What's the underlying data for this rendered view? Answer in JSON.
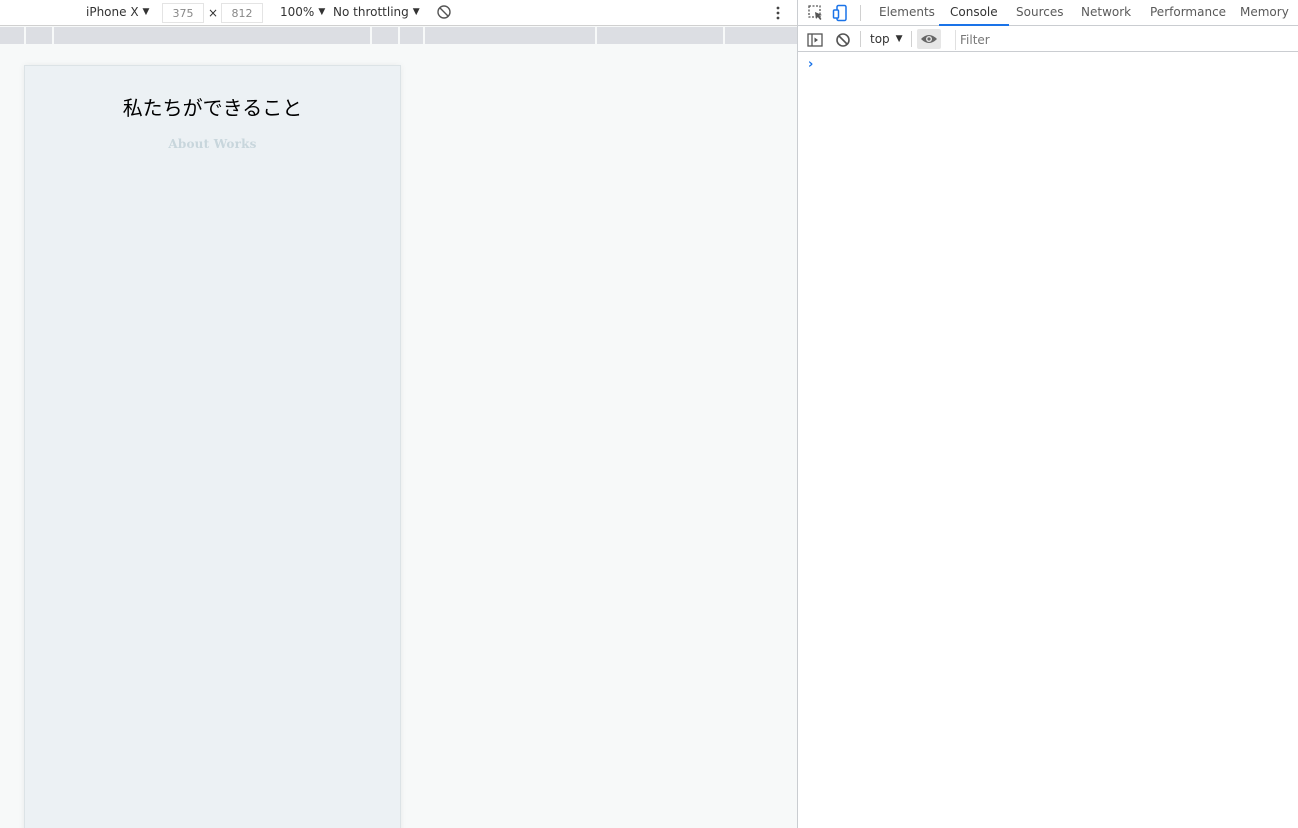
{
  "emulation_toolbar": {
    "device": "iPhone X",
    "width": "375",
    "height": "812",
    "times": "×",
    "zoom": "100%",
    "throttling": "No throttling"
  },
  "media_query_bar": {
    "segments": 11
  },
  "device_page": {
    "title": "私たちができること",
    "subtitle": "About Works",
    "subtitle_color": "#c8d6dc",
    "background": "#ecf1f4"
  },
  "devtools": {
    "tabs": [
      "Elements",
      "Console",
      "Sources",
      "Network",
      "Performance",
      "Memory"
    ],
    "active_tab": "Console",
    "accent": "#1a73e8",
    "console_toolbar": {
      "context": "top",
      "filter_placeholder": "Filter"
    },
    "prompt": "›"
  }
}
